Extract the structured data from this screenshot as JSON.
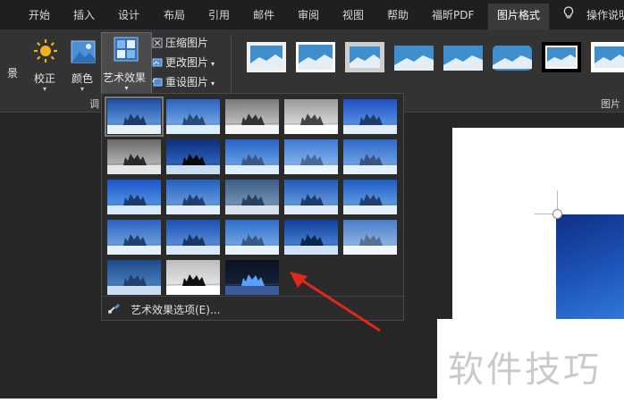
{
  "tabs": [
    "开始",
    "插入",
    "设计",
    "布局",
    "引用",
    "邮件",
    "审阅",
    "视图",
    "帮助",
    "福昕PDF",
    "图片格式",
    "操作说明"
  ],
  "active_tab": "图片格式",
  "ribbon": {
    "left_cut": "景",
    "correct_label": "校正",
    "color_label": "颜色",
    "art_label": "艺术效果",
    "compress_label": "压缩图片",
    "change_label": "更改图片",
    "reset_label": "重设图片",
    "adjust_group_label": "调",
    "styles_group_label": "图片"
  },
  "gallery": {
    "rows": [
      [
        "none",
        "pencil-sketch",
        "line-drawing",
        "chalk",
        "paint-strokes"
      ],
      [
        "grayscale",
        "silhouette",
        "blur",
        "light-screen",
        "watercolor"
      ],
      [
        "mosaic",
        "glass",
        "cement",
        "texturizer",
        "crisscross"
      ],
      [
        "pastels",
        "plastic-wrap",
        "photocopy",
        "glow-edges",
        "film-grain"
      ],
      [
        "cutout",
        "photocopy-bw",
        "glow-diffused"
      ]
    ],
    "selected": "none",
    "options_label": "艺术效果选项(E)..."
  },
  "watermark": "软件技巧",
  "colors": {
    "accent_arrow": "#e0291b",
    "tab_bar": "#1f1f1f",
    "ribbon": "#333333",
    "picture_blue": "#1d54b8"
  }
}
